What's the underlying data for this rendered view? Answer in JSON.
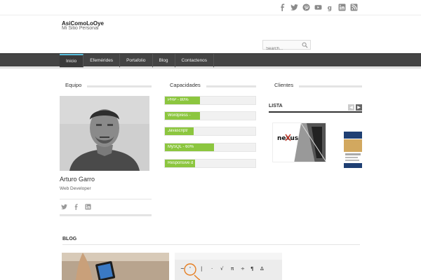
{
  "social": [
    "facebook-icon",
    "twitter-icon",
    "pinterest-icon",
    "youtube-icon",
    "google-plus-icon",
    "linkedin-icon",
    "rss-icon"
  ],
  "site": {
    "title": "AsiComoLoOye",
    "tagline": "Mi Sitio Personal"
  },
  "search": {
    "placeholder": "Search..."
  },
  "nav": {
    "items": [
      "Inicio",
      "Efemérides",
      "Portafolio",
      "Blog",
      "Contactenos"
    ]
  },
  "widgets": {
    "team": {
      "title": "Equipo",
      "member": {
        "name": "Arturo Garro",
        "role": "Web Developer"
      }
    },
    "skills": {
      "title": "Capacidades",
      "items": [
        {
          "label": "PHP - 80%",
          "percent": 39
        },
        {
          "label": "Wordpress -",
          "percent": 39
        },
        {
          "label": "Javascript/",
          "percent": 32
        },
        {
          "label": "MySQL - 60%",
          "percent": 54
        },
        {
          "label": "Responsive d",
          "percent": 33
        }
      ]
    },
    "clients": {
      "title": "Clientes",
      "list_label": "LISTA",
      "logo1": "nexus"
    }
  },
  "blog": {
    "title": "BLOG",
    "symbols": [
      "~",
      "'",
      "|",
      "·",
      "√",
      "π",
      "÷",
      "¶",
      "Δ"
    ]
  }
}
